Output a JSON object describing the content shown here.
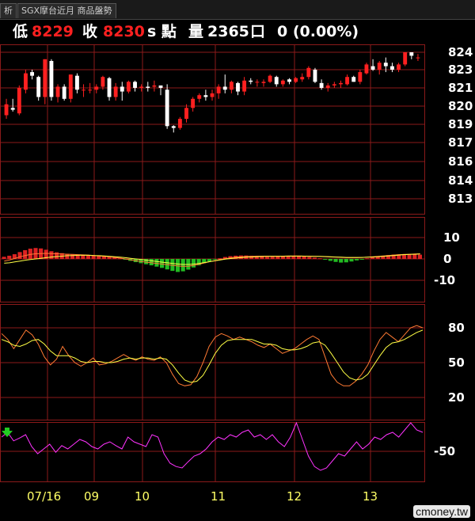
{
  "tabs": {
    "prev": "析",
    "main": "SGX摩台近月 商品盤勢"
  },
  "quote": {
    "low_label": "低",
    "low_value": "8229",
    "close_label": "收",
    "close_value": "8230",
    "unit": "s 點",
    "volume_label": "量",
    "volume_value": "2365",
    "volume_unit": "口",
    "change": "0 (0.00%)"
  },
  "colors": {
    "up": "#ff2020",
    "down": "#ffffff",
    "grid": "#8b1a1a",
    "axis_text": "#ffffff",
    "date_text": "#ffff66",
    "macd_pos": "#dd2222",
    "macd_neg": "#22bb22",
    "k_line": "#ff7a33",
    "d_line": "#ffff44",
    "osc_line": "#ff33ff"
  },
  "chart_data": [
    {
      "type": "candlestick",
      "y_ticks": [
        "824",
        "823",
        "821",
        "820",
        "819",
        "817",
        "816",
        "814",
        "813"
      ],
      "x_ticks": [
        "07/16",
        "09",
        "10",
        "11",
        "12",
        "13"
      ],
      "ohlc": [
        [
          8200,
          8209,
          8198,
          8206
        ],
        [
          8204,
          8209,
          8202,
          8203
        ],
        [
          8201,
          8217,
          8200,
          8215
        ],
        [
          8214,
          8230,
          8212,
          8227
        ],
        [
          8228,
          8230,
          8222,
          8225
        ],
        [
          8224,
          8225,
          8208,
          8210
        ],
        [
          8210,
          8236,
          8206,
          8236
        ],
        [
          8235,
          8236,
          8208,
          8210
        ],
        [
          8210,
          8218,
          8207,
          8216
        ],
        [
          8216,
          8218,
          8208,
          8209
        ],
        [
          8209,
          8226,
          8207,
          8226
        ],
        [
          8225,
          8227,
          8212,
          8214
        ],
        [
          8214,
          8218,
          8210,
          8214
        ],
        [
          8214,
          8219,
          8212,
          8214
        ],
        [
          8214,
          8218,
          8212,
          8216
        ],
        [
          8216,
          8225,
          8214,
          8224
        ],
        [
          8223,
          8224,
          8208,
          8210
        ],
        [
          8210,
          8219,
          8208,
          8216
        ],
        [
          8216,
          8220,
          8208,
          8213
        ],
        [
          8213,
          8221,
          8212,
          8220
        ],
        [
          8220,
          8221,
          8213,
          8215
        ],
        [
          8215,
          8218,
          8213,
          8216
        ],
        [
          8216,
          8220,
          8213,
          8215
        ],
        [
          8216,
          8221,
          8213,
          8217
        ],
        [
          8217,
          8217,
          8211,
          8215
        ],
        [
          8214,
          8218,
          8190,
          8193
        ],
        [
          8193,
          8194,
          8186,
          8191
        ],
        [
          8191,
          8199,
          8189,
          8198
        ],
        [
          8198,
          8206,
          8196,
          8204
        ],
        [
          8204,
          8210,
          8202,
          8209
        ],
        [
          8209,
          8212,
          8207,
          8211
        ],
        [
          8211,
          8214,
          8208,
          8210
        ],
        [
          8210,
          8214,
          8208,
          8212
        ],
        [
          8212,
          8218,
          8209,
          8216
        ],
        [
          8216,
          8226,
          8212,
          8214
        ],
        [
          8214,
          8221,
          8212,
          8220
        ],
        [
          8219,
          8220,
          8211,
          8213
        ],
        [
          8213,
          8224,
          8211,
          8221
        ],
        [
          8221,
          8223,
          8218,
          8220
        ],
        [
          8220,
          8222,
          8216,
          8220
        ],
        [
          8219,
          8222,
          8216,
          8220
        ],
        [
          8220,
          8226,
          8219,
          8225
        ],
        [
          8224,
          8225,
          8216,
          8218
        ],
        [
          8218,
          8222,
          8216,
          8221
        ],
        [
          8222,
          8223,
          8218,
          8220
        ],
        [
          8220,
          8224,
          8219,
          8223
        ],
        [
          8222,
          8227,
          8220,
          8224
        ],
        [
          8224,
          8232,
          8222,
          8231
        ],
        [
          8230,
          8231,
          8219,
          8220
        ],
        [
          8219,
          8222,
          8214,
          8215
        ],
        [
          8215,
          8219,
          8213,
          8217
        ],
        [
          8217,
          8220,
          8215,
          8218
        ],
        [
          8218,
          8221,
          8215,
          8219
        ],
        [
          8218,
          8226,
          8217,
          8224
        ],
        [
          8224,
          8225,
          8220,
          8220
        ],
        [
          8220,
          8230,
          8218,
          8228
        ],
        [
          8227,
          8234,
          8226,
          8233
        ],
        [
          8232,
          8236,
          8229,
          8230
        ],
        [
          8230,
          8235,
          8226,
          8234
        ],
        [
          8234,
          8237,
          8228,
          8232
        ],
        [
          8232,
          8234,
          8228,
          8230
        ],
        [
          8230,
          8234,
          8228,
          8233
        ],
        [
          8233,
          8242,
          8232,
          8240
        ],
        [
          8240,
          8241,
          8236,
          8238
        ],
        [
          8237,
          8239,
          8235,
          8237
        ]
      ]
    },
    {
      "type": "bar+line",
      "y_ticks": [
        "10",
        "0",
        "-10"
      ],
      "series": [
        {
          "values": [
            1.0,
            1.5,
            2.2,
            3.2,
            4.1,
            4.8,
            5.1,
            4.9,
            4.3,
            3.6,
            3.1,
            2.7,
            2.4,
            2.2,
            2.0,
            1.9,
            1.7,
            1.6,
            1.5,
            1.3,
            1.0,
            0.7,
            0.3,
            -0.3,
            -0.9,
            -1.5,
            -2.0,
            -2.5,
            -3.0,
            -3.6,
            -4.2,
            -4.9,
            -5.6,
            -6.1,
            -5.8,
            -5.0,
            -4.0,
            -3.0,
            -2.0,
            -1.2,
            -0.3,
            0.3,
            0.9,
            1.3,
            1.5,
            1.6,
            1.6,
            1.5,
            1.3,
            1.1,
            1.0,
            1.0,
            1.1,
            1.2,
            1.3,
            1.4,
            1.3,
            1.1,
            0.9,
            0.6,
            0.3,
            -0.3,
            -0.9,
            -1.4,
            -1.7,
            -1.6,
            -1.2,
            -0.7,
            -0.2,
            0.3,
            0.7,
            1.1,
            1.5,
            1.8,
            2.0,
            2.1,
            2.2,
            2.2,
            2.1,
            2.0
          ]
        },
        {
          "values": [
            -1.0,
            -0.5,
            0.2,
            1.0,
            1.6,
            2.1,
            2.4,
            2.5,
            2.6,
            2.5,
            2.4,
            2.3,
            2.2,
            2.1,
            2.0,
            1.9,
            1.8,
            1.6,
            1.4,
            1.2,
            1.0,
            0.7,
            0.4,
            0.0,
            -0.4,
            -0.8,
            -1.2,
            -1.5,
            -1.8,
            -2.1,
            -2.4,
            -2.7,
            -3.0,
            -3.3,
            -3.5,
            -3.4,
            -3.0,
            -2.5,
            -1.9,
            -1.3,
            -0.8,
            -0.3,
            0.1,
            0.5,
            0.8,
            1.0,
            1.1,
            1.2,
            1.3,
            1.3,
            1.3,
            1.3,
            1.3,
            1.3,
            1.4,
            1.4,
            1.4,
            1.3,
            1.3,
            1.2,
            1.1,
            1.0,
            0.9,
            0.8,
            0.7,
            0.6,
            0.6,
            0.6,
            0.7,
            0.8,
            1.0,
            1.2,
            1.4,
            1.6,
            1.8,
            2.0,
            2.1,
            2.2,
            2.3,
            2.4
          ]
        },
        {
          "values": [
            -2.0,
            -1.8,
            -1.4,
            -1.0,
            -0.6,
            -0.3,
            0.0,
            0.3,
            0.6,
            0.9,
            1.1,
            1.3,
            1.5,
            1.6,
            1.7,
            1.7,
            1.7,
            1.6,
            1.5,
            1.4,
            1.2,
            1.0,
            0.8,
            0.6,
            0.3,
            0.0,
            -0.3,
            -0.6,
            -0.9,
            -1.2,
            -1.5,
            -1.8,
            -2.1,
            -2.4,
            -2.6,
            -2.6,
            -2.4,
            -2.1,
            -1.7,
            -1.3,
            -0.9,
            -0.5,
            -0.1,
            0.2,
            0.4,
            0.6,
            0.8,
            0.9,
            1.0,
            1.1,
            1.2,
            1.2,
            1.2,
            1.2,
            1.3,
            1.3,
            1.3,
            1.3,
            1.2,
            1.2,
            1.2,
            1.1,
            1.0,
            0.9,
            0.8,
            0.7,
            0.7,
            0.7,
            0.7,
            0.8,
            0.9,
            1.0,
            1.2,
            1.4,
            1.6,
            1.8,
            2.0,
            2.1,
            2.2,
            2.3
          ]
        }
      ]
    },
    {
      "type": "line",
      "y_ticks": [
        "80",
        "50",
        "20"
      ],
      "series": [
        {
          "values": [
            75,
            70,
            62,
            70,
            78,
            74,
            66,
            55,
            48,
            53,
            64,
            56,
            50,
            47,
            50,
            54,
            48,
            49,
            51,
            54,
            57,
            54,
            52,
            55,
            53,
            52,
            55,
            50,
            40,
            32,
            30,
            31,
            38,
            50,
            64,
            72,
            75,
            73,
            70,
            72,
            70,
            68,
            65,
            63,
            66,
            62,
            58,
            60,
            62,
            66,
            70,
            73,
            70,
            55,
            40,
            33,
            30,
            30,
            34,
            40,
            48,
            60,
            70,
            76,
            72,
            68,
            74,
            80,
            82,
            80
          ]
        },
        {
          "values": [
            70,
            68,
            65,
            64,
            66,
            69,
            70,
            66,
            60,
            56,
            56,
            56,
            54,
            51,
            50,
            51,
            51,
            50,
            50,
            51,
            53,
            54,
            53,
            54,
            54,
            53,
            54,
            53,
            48,
            41,
            35,
            33,
            34,
            39,
            48,
            58,
            65,
            69,
            70,
            70,
            70,
            70,
            68,
            66,
            66,
            65,
            62,
            61,
            61,
            62,
            64,
            67,
            68,
            65,
            58,
            50,
            42,
            37,
            35,
            36,
            40,
            48,
            56,
            63,
            67,
            68,
            70,
            73,
            76,
            78
          ]
        }
      ]
    },
    {
      "type": "line",
      "y_ticks": [
        "-50"
      ],
      "series": [
        {
          "values": [
            -20,
            -10,
            -28,
            -22,
            -15,
            -40,
            -55,
            -45,
            -35,
            -52,
            -38,
            -45,
            -35,
            -25,
            -30,
            -40,
            -45,
            -35,
            -30,
            -38,
            -45,
            -20,
            -30,
            -35,
            -40,
            -15,
            -20,
            -55,
            -75,
            -82,
            -85,
            -72,
            -60,
            -55,
            -45,
            -30,
            -20,
            -25,
            -15,
            -20,
            -10,
            -5,
            -20,
            -15,
            -25,
            -15,
            -30,
            -40,
            -20,
            10,
            -25,
            -60,
            -82,
            -90,
            -85,
            -70,
            -55,
            -60,
            -45,
            -30,
            -45,
            -35,
            -20,
            -25,
            -15,
            -10,
            -20,
            -5,
            10,
            -5,
            -10
          ]
        }
      ]
    }
  ]
}
